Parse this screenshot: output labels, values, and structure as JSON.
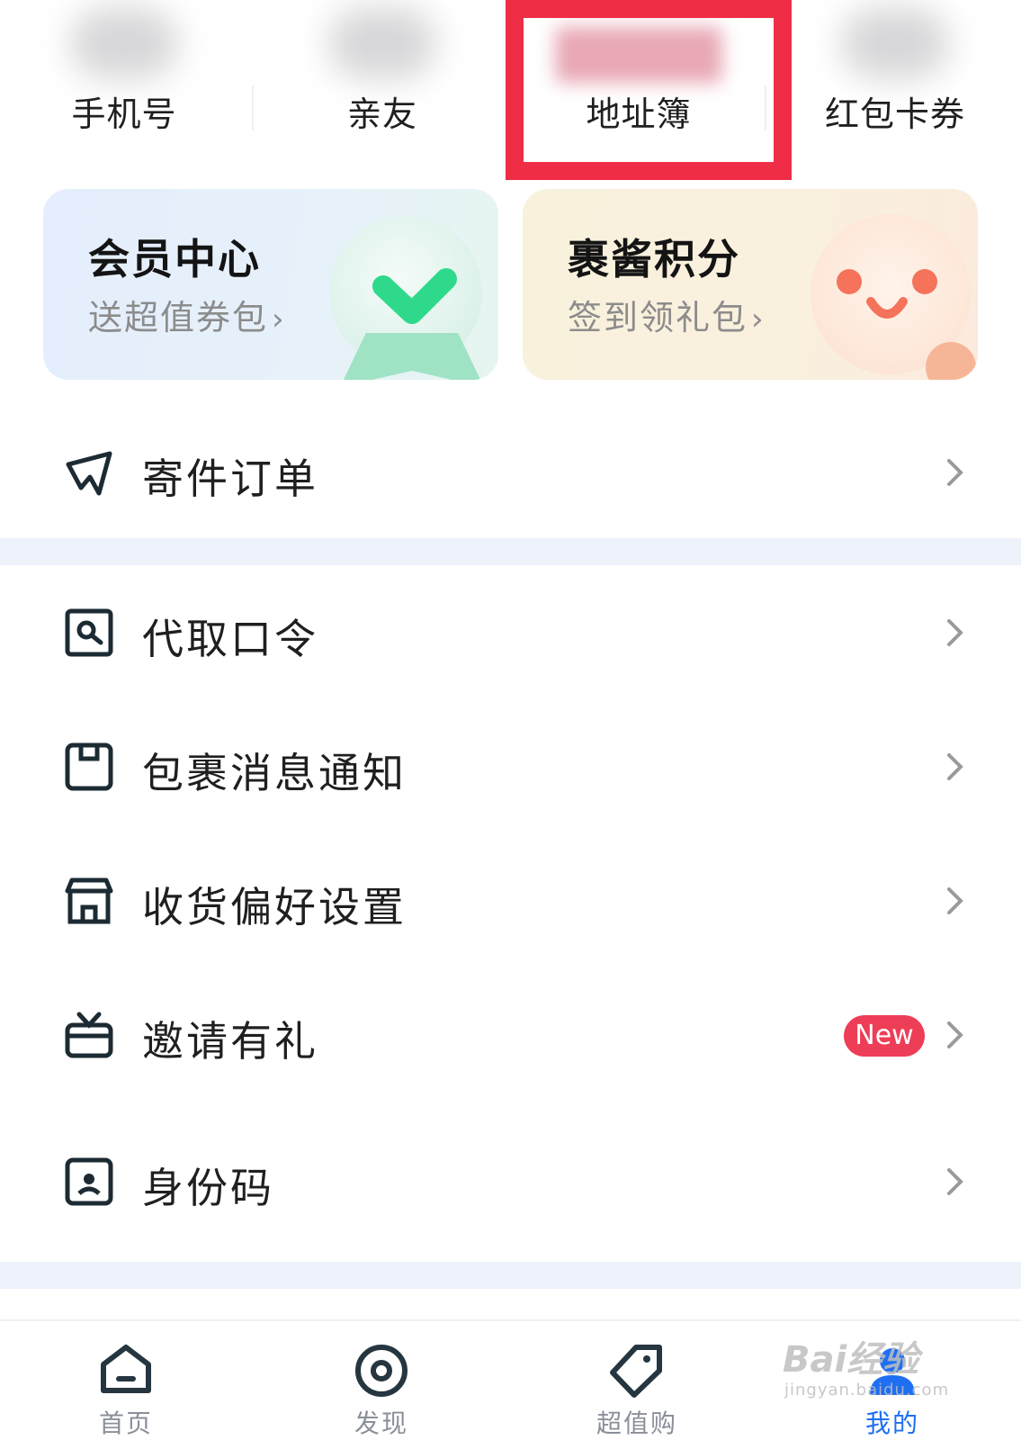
{
  "quick": {
    "items": [
      {
        "label": "手机号"
      },
      {
        "label": "亲友"
      },
      {
        "label": "地址簿"
      },
      {
        "label": "红包卡券"
      }
    ]
  },
  "cards": {
    "vip": {
      "title": "会员中心",
      "subtitle": "送超值券包"
    },
    "points": {
      "title": "裹酱积分",
      "subtitle": "签到领礼包"
    }
  },
  "menu": {
    "send_orders": "寄件订单",
    "pickup_code": "代取口令",
    "package_notify": "包裹消息通知",
    "delivery_prefs": "收货偏好设置",
    "invite": "邀请有礼",
    "invite_badge": "New",
    "identity_code": "身份码"
  },
  "tabs": [
    {
      "label": "首页"
    },
    {
      "label": "发现"
    },
    {
      "label": "超值购"
    },
    {
      "label": "我的"
    }
  ],
  "colors": {
    "accent": "#1e6ff1",
    "highlight_box": "#ef2d46",
    "badge": "#ee3d56",
    "section_gap": "#eef2fb"
  },
  "watermark": {
    "line1": "Bai经验",
    "line2": "jingyan.baidu.com"
  }
}
